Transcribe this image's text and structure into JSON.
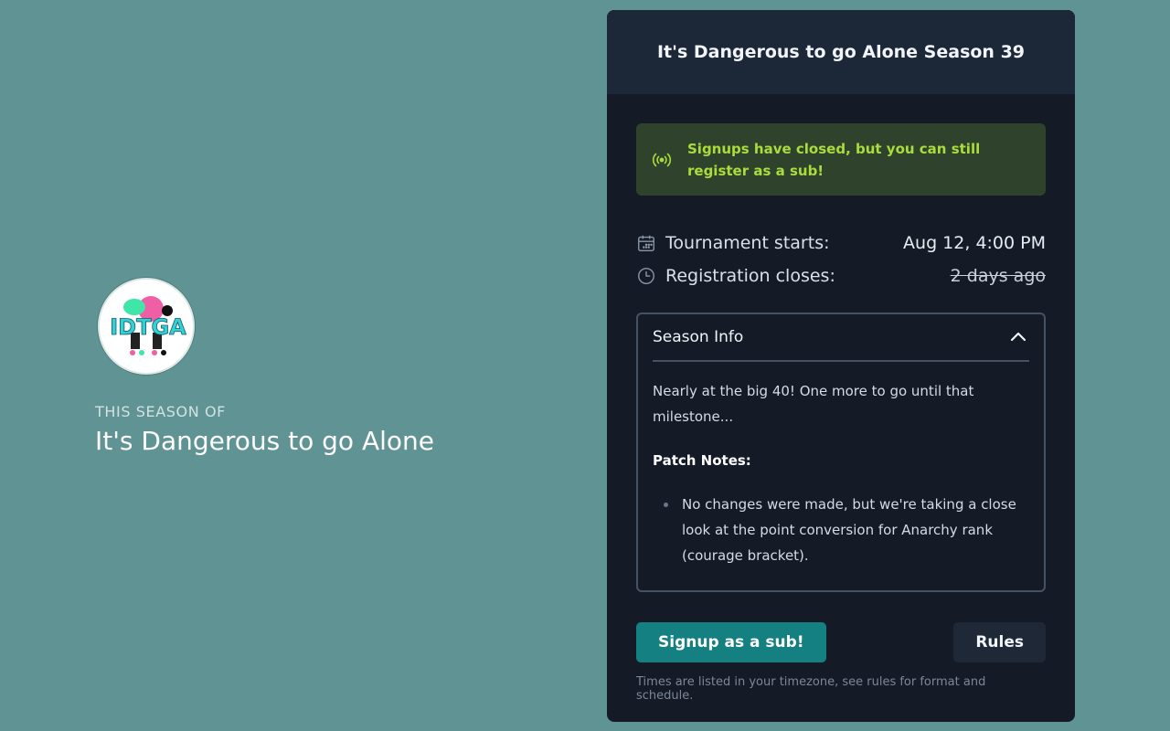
{
  "org": {
    "logo_text": "IDTGA",
    "eyebrow": "THIS SEASON OF",
    "name": "It's Dangerous to go Alone"
  },
  "card": {
    "title": "It's Dangerous to go Alone Season 39",
    "alert": {
      "icon": "broadcast-icon",
      "text": "Signups have closed, but you can still register as a sub!",
      "color": "#a9dc3c"
    },
    "meta": {
      "tournament_label": "Tournament starts:",
      "tournament_value": "Aug 12, 4:00 PM",
      "registration_label": "Registration closes:",
      "registration_value": "2 days ago"
    },
    "season_info": {
      "title": "Season Info",
      "intro": "Nearly at the big 40! One more to go until that milestone...",
      "patch_title": "Patch Notes:",
      "patch_items": [
        "No changes were made, but we're taking a close look at the point conversion for Anarchy rank (courage bracket)."
      ]
    },
    "actions": {
      "signup_label": "Signup as a sub!",
      "rules_label": "Rules"
    },
    "footnote": "Times are listed in your timezone, see rules for format and schedule."
  },
  "colors": {
    "background": "#609393",
    "card": "#141b27",
    "primary_button": "#158081"
  }
}
